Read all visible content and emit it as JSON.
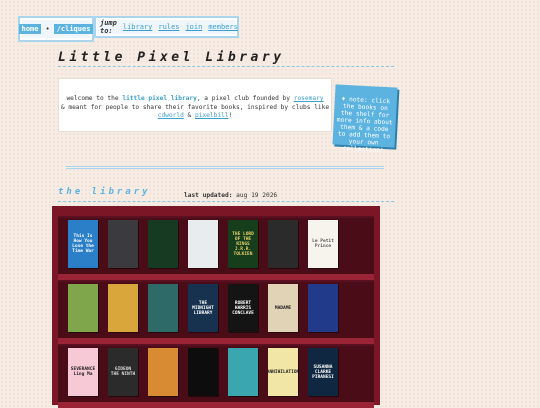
{
  "nav": {
    "home": "home",
    "cliques": "/cliques",
    "separator": "•",
    "jump_label": "jump to:",
    "links": [
      "library",
      "rules",
      "join",
      "members"
    ]
  },
  "page_title": "Little Pixel Library",
  "welcome": {
    "t1": "welcome to the ",
    "club": "little pixel library",
    "t2": ", a pixel club founded by ",
    "founder": "rosemary",
    "t3": "& meant for people to share their favorite books, inspired by clubs like ",
    "link1": "cdworld",
    "amp": " & ",
    "link2": "pixelbill",
    "t4": "!"
  },
  "note": "♦ note: click the books on the shelf for more info about them & a code to add them to your own collection!",
  "library_title": "the library",
  "updated": {
    "label": "last updated:",
    "date": "aug 19 2026"
  },
  "colors": {
    "accent": "#5cb3e0",
    "shelf": "#7a1626",
    "background": "#f6ece3"
  },
  "books": [
    [
      {
        "title": "This Is How You Lose the Time War",
        "bg": "#2b7fc9",
        "fg": "#ffffff"
      },
      {
        "title": "",
        "bg": "#3b3b3f",
        "fg": "#cccccc"
      },
      {
        "title": "",
        "bg": "#173a22",
        "fg": "#9bd37b"
      },
      {
        "title": "",
        "bg": "#e9ecef",
        "fg": "#333333"
      },
      {
        "title": "THE LORD OF THE RINGS J.R.R. TOLKIEN",
        "bg": "#163d1c",
        "fg": "#e8d26a"
      },
      {
        "title": "",
        "bg": "#2b2b2b",
        "fg": "#cccccc"
      },
      {
        "title": "Le Petit Prince",
        "bg": "#f7f4ee",
        "fg": "#555555"
      }
    ],
    [
      {
        "title": "",
        "bg": "#7fa64a",
        "fg": "#ffffff"
      },
      {
        "title": "",
        "bg": "#d8a63b",
        "fg": "#ffffff"
      },
      {
        "title": "",
        "bg": "#2e6b68",
        "fg": "#f0e0a0"
      },
      {
        "title": "THE MIDNIGHT LIBRARY",
        "bg": "#16324f",
        "fg": "#ffffff"
      },
      {
        "title": "ROBERT HARRIS CONCLAVE",
        "bg": "#141414",
        "fg": "#ffffff"
      },
      {
        "title": "MADAME",
        "bg": "#e1d4b6",
        "fg": "#222222"
      },
      {
        "title": "",
        "bg": "#213a8a",
        "fg": "#ffffff"
      }
    ],
    [
      {
        "title": "SEVERANCE Ling Ma",
        "bg": "#f7c8d6",
        "fg": "#222222"
      },
      {
        "title": "GIDEON THE NINTH",
        "bg": "#2b2b2b",
        "fg": "#dddddd"
      },
      {
        "title": "",
        "bg": "#d98b34",
        "fg": "#ffffff"
      },
      {
        "title": "",
        "bg": "#0d0d0d",
        "fg": "#cc2b2b"
      },
      {
        "title": "",
        "bg": "#3aa6b0",
        "fg": "#ffffff"
      },
      {
        "title": "ANNIHILATION",
        "bg": "#f1e6a6",
        "fg": "#222222"
      },
      {
        "title": "SUSANNA CLARKE PIRANESI",
        "bg": "#0f2740",
        "fg": "#ffffff"
      }
    ]
  ]
}
